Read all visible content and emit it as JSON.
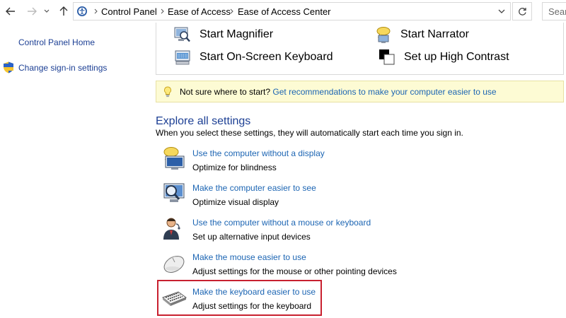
{
  "address_bar": {
    "breadcrumbs": [
      "Control Panel",
      "Ease of Access",
      "Ease of Access Center"
    ],
    "search_placeholder": "Searc"
  },
  "left_pane": {
    "home_link": "Control Panel Home",
    "signin_link": "Change sign-in settings"
  },
  "quick_access": [
    {
      "label": "Start Magnifier",
      "icon": "magnifier-icon"
    },
    {
      "label": "Start Narrator",
      "icon": "narrator-icon"
    },
    {
      "label": "Start On-Screen Keyboard",
      "icon": "onscreen-keyboard-icon"
    },
    {
      "label": "Set up High Contrast",
      "icon": "high-contrast-icon"
    }
  ],
  "tip": {
    "text": "Not sure where to start?",
    "link": "Get recommendations to make your computer easier to use"
  },
  "explore": {
    "title": "Explore all settings",
    "subtitle": "When you select these settings, they will automatically start each time you sign in.",
    "items": [
      {
        "link": "Use the computer without a display",
        "desc": "Optimize for blindness",
        "icon": "monitor-speech-icon"
      },
      {
        "link": "Make the computer easier to see",
        "desc": "Optimize visual display",
        "icon": "monitor-magnifier-icon"
      },
      {
        "link": "Use the computer without a mouse or keyboard",
        "desc": "Set up alternative input devices",
        "icon": "user-speech-icon"
      },
      {
        "link": "Make the mouse easier to use",
        "desc": "Adjust settings for the mouse or other pointing devices",
        "icon": "mouse-icon"
      },
      {
        "link": "Make the keyboard easier to use",
        "desc": "Adjust settings for the keyboard",
        "icon": "keyboard-icon"
      }
    ]
  },
  "colors": {
    "link": "#1c65b3",
    "heading": "#1c3f94",
    "tip_background": "#fdfbd4",
    "highlight": "#c8202f"
  }
}
